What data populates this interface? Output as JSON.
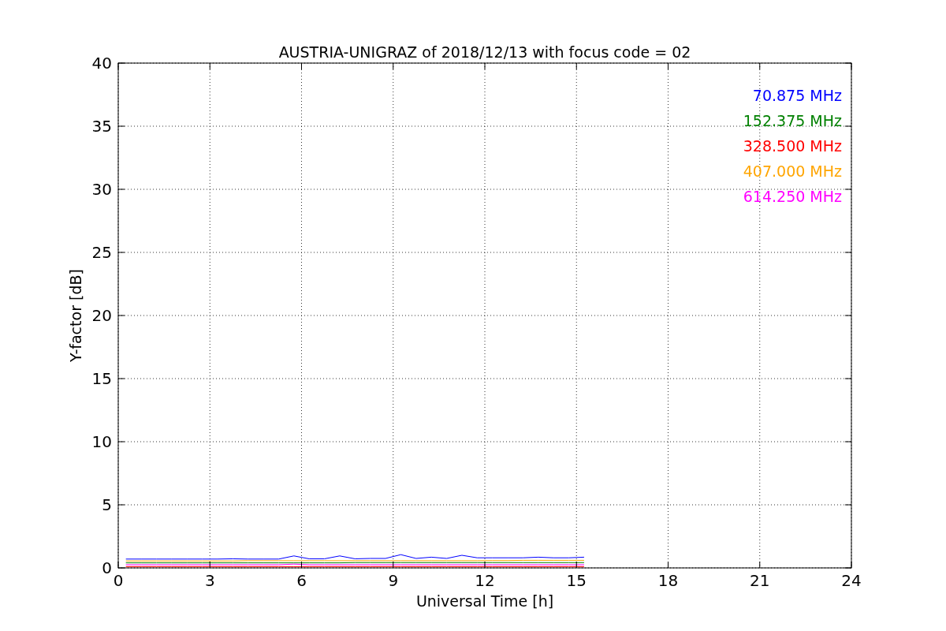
{
  "chart_data": {
    "type": "line",
    "title": "AUSTRIA-UNIGRAZ of 2018/12/13 with focus code = 02",
    "xlabel": "Universal Time [h]",
    "ylabel": "Y-factor [dB]",
    "x": [
      0.25,
      0.75,
      1.25,
      1.75,
      2.25,
      2.75,
      3.25,
      3.75,
      4.25,
      4.75,
      5.25,
      5.75,
      6.25,
      6.75,
      7.25,
      7.75,
      8.25,
      8.75,
      9.25,
      9.75,
      10.25,
      10.75,
      11.25,
      11.75,
      12.25,
      12.75,
      13.25,
      13.75,
      14.25,
      14.75,
      15.25
    ],
    "series": [
      {
        "name": "70.875 MHz",
        "color": "#0000ff",
        "values": [
          0.7,
          0.7,
          0.7,
          0.7,
          0.7,
          0.7,
          0.7,
          0.72,
          0.7,
          0.7,
          0.7,
          0.95,
          0.72,
          0.72,
          0.95,
          0.72,
          0.75,
          0.75,
          1.05,
          0.75,
          0.85,
          0.75,
          1.0,
          0.8,
          0.8,
          0.8,
          0.8,
          0.85,
          0.8,
          0.8,
          0.85
        ]
      },
      {
        "name": "152.375 MHz",
        "color": "#008000",
        "values": [
          0.4,
          0.4,
          0.4,
          0.4,
          0.4,
          0.4,
          0.4,
          0.4,
          0.4,
          0.4,
          0.4,
          0.4,
          0.4,
          0.4,
          0.4,
          0.42,
          0.42,
          0.42,
          0.42,
          0.42,
          0.42,
          0.42,
          0.42,
          0.42,
          0.42,
          0.42,
          0.42,
          0.42,
          0.42,
          0.42,
          0.42
        ]
      },
      {
        "name": "328.500 MHz",
        "color": "#ff0000",
        "values": [
          0.1,
          0.1,
          0.1,
          0.1,
          0.1,
          0.1,
          0.1,
          0.1,
          0.1,
          0.1,
          0.1,
          0.1,
          0.1,
          0.1,
          0.1,
          0.1,
          0.1,
          0.1,
          0.1,
          0.1,
          0.1,
          0.1,
          0.1,
          0.1,
          0.1,
          0.1,
          0.1,
          0.1,
          0.1,
          0.1,
          0.1
        ]
      },
      {
        "name": "407.000 MHz",
        "color": "#ffa500",
        "values": [
          0.55,
          0.55,
          0.55,
          0.55,
          0.55,
          0.55,
          0.55,
          0.55,
          0.57,
          0.57,
          0.57,
          0.57,
          0.57,
          0.57,
          0.57,
          0.57,
          0.57,
          0.57,
          0.57,
          0.57,
          0.57,
          0.57,
          0.57,
          0.57,
          0.58,
          0.58,
          0.6,
          0.6,
          0.6,
          0.6,
          0.6
        ]
      },
      {
        "name": "614.250 MHz",
        "color": "#ff00ff",
        "values": [
          0.25,
          0.25,
          0.25,
          0.25,
          0.25,
          0.25,
          0.25,
          0.25,
          0.25,
          0.25,
          0.25,
          0.3,
          0.25,
          0.25,
          0.25,
          0.25,
          0.25,
          0.25,
          0.25,
          0.25,
          0.25,
          0.25,
          0.25,
          0.25,
          0.25,
          0.25,
          0.25,
          0.25,
          0.25,
          0.25,
          0.25
        ]
      }
    ],
    "xlim": [
      0,
      24
    ],
    "ylim": [
      0,
      40
    ],
    "xticks": [
      0,
      3,
      6,
      9,
      12,
      15,
      18,
      21,
      24
    ],
    "yticks": [
      0,
      5,
      10,
      15,
      20,
      25,
      30,
      35,
      40
    ],
    "grid": true
  }
}
